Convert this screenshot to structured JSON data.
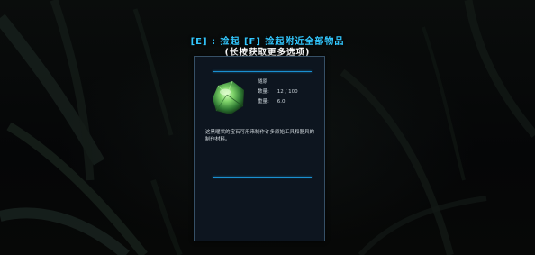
{
  "prompts": {
    "line1": "[E] : 捡起   [F] 捡起附近全部物品",
    "line2": "(长按获取更多选项)"
  },
  "item": {
    "icon": "green-gem-icon",
    "name": "燧原",
    "quantity_label": "数量:",
    "quantity_value": "12  /  100",
    "weight_label": "重量:",
    "weight_value": "6.0",
    "description": "这黑曜状的宝石可用来制作许多原始工具和器具的制作材料。"
  },
  "colors": {
    "prompt_accent": "#33c8ff",
    "rule": "#1a8fd0",
    "panel_bg": "#0e1620"
  }
}
